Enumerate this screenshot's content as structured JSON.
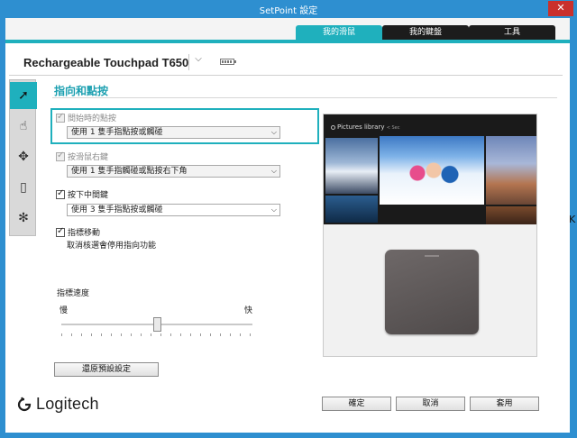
{
  "window": {
    "title": "SetPoint 設定",
    "close_glyph": "✕"
  },
  "tabs": [
    {
      "label": "我的滑鼠",
      "active": true
    },
    {
      "label": "我的鍵盤",
      "active": false
    },
    {
      "label": "工具",
      "active": false
    }
  ],
  "device": {
    "name": "Rechargeable Touchpad T650",
    "chevron": "⌵",
    "battery_icon": "battery-icon"
  },
  "rail": [
    {
      "icon": "pointer-gesture-icon",
      "glyph": "➚",
      "active": true
    },
    {
      "icon": "hand-icon",
      "glyph": "☝",
      "active": false
    },
    {
      "icon": "move-arrows-icon",
      "glyph": "✥",
      "active": false
    },
    {
      "icon": "battery-vertical-icon",
      "glyph": "▯",
      "active": false
    },
    {
      "icon": "logitech-settings-icon",
      "glyph": "✻",
      "active": false
    }
  ],
  "section": {
    "title": "指向和點按"
  },
  "settings": {
    "tap_click": {
      "label": "間始時的點按",
      "checked": true,
      "enabled": false,
      "select_value": "使用 1 隻手指點按或觸碰"
    },
    "right_click": {
      "label": "按滑鼠右鍵",
      "checked": true,
      "enabled": false,
      "select_value": "使用 1 隻手指觸碰或點按右下角"
    },
    "middle_click": {
      "label": "按下中間鍵",
      "checked": true,
      "enabled": true,
      "select_value": "使用 3 隻手指點按或觸碰"
    },
    "pointer_move": {
      "label": "指標移動",
      "checked": true,
      "enabled": true,
      "note": "取消核選會停用指向功能"
    }
  },
  "speed": {
    "label": "指標速度",
    "slow": "慢",
    "fast": "快",
    "level": 0.5
  },
  "restore_button": "還原預設設定",
  "preview": {
    "library_label": "Pictures library",
    "library_sub": "< Sec"
  },
  "footer": {
    "brand": "Logitech",
    "ok": "確定",
    "cancel": "取消",
    "apply": "套用"
  },
  "edge_glyph": "K"
}
